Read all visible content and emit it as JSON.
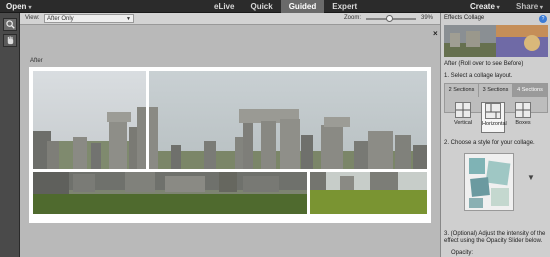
{
  "topbar": {
    "open_label": "Open",
    "modes": [
      {
        "label": "eLive",
        "active": false
      },
      {
        "label": "Quick",
        "active": false
      },
      {
        "label": "Guided",
        "active": true
      },
      {
        "label": "Expert",
        "active": false
      }
    ],
    "create_label": "Create",
    "share_label": "Share"
  },
  "options": {
    "view_label": "View:",
    "view_value": "After Only",
    "zoom_label": "Zoom:",
    "zoom_value": "39%",
    "zoom_fraction": 0.39
  },
  "canvas": {
    "after_label": "After",
    "close_glyph": "×"
  },
  "right_panel": {
    "title": "Effects Collage",
    "help_glyph": "?",
    "after_hint": "After (Roll over to see Before)",
    "step1": "1. Select a collage layout.",
    "section_tabs": [
      "2 Sections",
      "3 Sections",
      "4 Sections"
    ],
    "active_section_tab": 2,
    "layout_options": [
      "Vertical",
      "Horizontal",
      "Boxes"
    ],
    "active_layout": 1,
    "step2": "2. Choose a style for your collage.",
    "step3": "3. (Optional) Adjust the intensity of the effect using the Opacity Slider below.",
    "opacity_label": "Opacity:"
  },
  "icons": {
    "zoom_tool": "magnifier-icon",
    "hand_tool": "hand-icon",
    "help": "help-icon"
  },
  "colors": {
    "active_mode_bg": "#6a6a6a",
    "help_blue": "#3a7bd5",
    "panel_bg": "#cfcfcf"
  }
}
